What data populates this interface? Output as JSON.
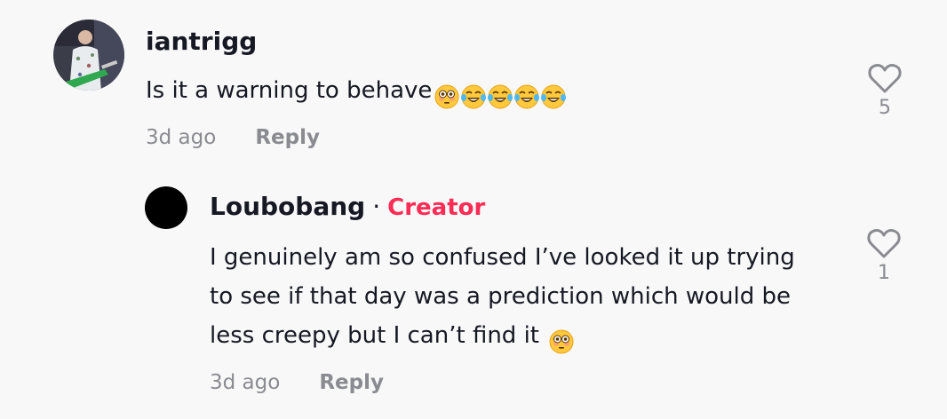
{
  "comment": {
    "username": "iantrigg",
    "text": "Is it a warning to behave",
    "emojis": [
      "flushed-face",
      "tears-of-joy",
      "tears-of-joy",
      "tears-of-joy",
      "tears-of-joy"
    ],
    "time": "3d ago",
    "reply_label": "Reply",
    "likes": "5"
  },
  "reply": {
    "username": "Loubobang",
    "separator": "·",
    "badge": "Creator",
    "text_lines": [
      "I genuinely am so confused I’ve looked it up trying",
      "to see if that day was a prediction which would be",
      "less creepy but I can’t find it "
    ],
    "emojis": [
      "flushed-face"
    ],
    "time": "3d ago",
    "reply_label": "Reply",
    "likes": "1"
  },
  "colors": {
    "background": "#f8f8f8",
    "text_primary": "#161823",
    "text_secondary": "#8a8b91",
    "creator_badge": "#fe2c55"
  }
}
